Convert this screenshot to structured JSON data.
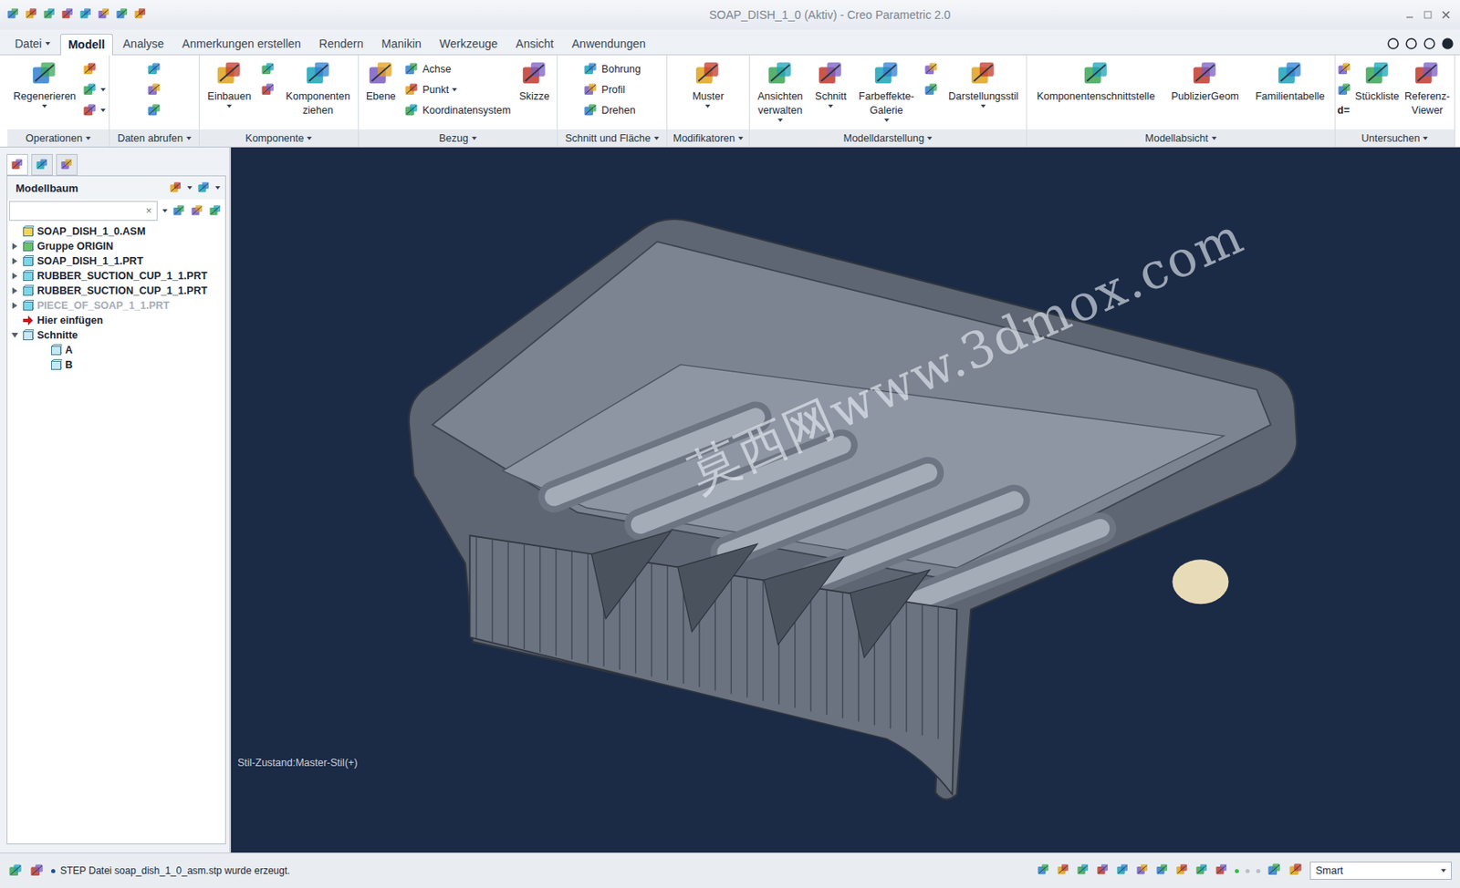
{
  "window": {
    "title": "SOAP_DISH_1_0 (Aktiv) - Creo Parametric 2.0"
  },
  "tabs": [
    {
      "label": "Datei",
      "selected": false,
      "dropdown": true
    },
    {
      "label": "Modell",
      "selected": true,
      "dropdown": false
    },
    {
      "label": "Analyse",
      "selected": false,
      "dropdown": false
    },
    {
      "label": "Anmerkungen erstellen",
      "selected": false,
      "dropdown": false
    },
    {
      "label": "Rendern",
      "selected": false,
      "dropdown": false
    },
    {
      "label": "Manikin",
      "selected": false,
      "dropdown": false
    },
    {
      "label": "Werkzeuge",
      "selected": false,
      "dropdown": false
    },
    {
      "label": "Ansicht",
      "selected": false,
      "dropdown": false
    },
    {
      "label": "Anwendungen",
      "selected": false,
      "dropdown": false
    }
  ],
  "ribbon": [
    {
      "label": "Operationen",
      "dropdown": true,
      "columns": [
        {
          "kind": "large",
          "lines": [
            "Regenerieren"
          ],
          "dropdown": true
        },
        {
          "kind": "stack",
          "items": [
            {
              "label": "",
              "dropdown": false
            },
            {
              "label": "",
              "dropdown": true
            },
            {
              "label": "",
              "dropdown": true
            }
          ]
        }
      ]
    },
    {
      "label": "Daten abrufen",
      "dropdown": true,
      "columns": [
        {
          "kind": "stack",
          "items": [
            {
              "label": "",
              "dropdown": false
            },
            {
              "label": "",
              "dropdown": false
            },
            {
              "label": "",
              "dropdown": false
            }
          ]
        }
      ]
    },
    {
      "label": "Komponente",
      "dropdown": true,
      "columns": [
        {
          "kind": "large",
          "lines": [
            "Einbauen"
          ],
          "dropdown": true
        },
        {
          "kind": "stack",
          "items": [
            {
              "label": "",
              "dropdown": false
            },
            {
              "label": "",
              "dropdown": false
            }
          ]
        },
        {
          "kind": "large",
          "lines": [
            "Komponenten",
            "ziehen"
          ],
          "dropdown": false
        }
      ]
    },
    {
      "label": "Bezug",
      "dropdown": true,
      "columns": [
        {
          "kind": "large",
          "lines": [
            "Ebene"
          ],
          "dropdown": false
        },
        {
          "kind": "stack",
          "items": [
            {
              "label": "Achse",
              "dropdown": false
            },
            {
              "label": "Punkt",
              "dropdown": true
            },
            {
              "label": "Koordinatensystem",
              "dropdown": false
            }
          ]
        },
        {
          "kind": "large",
          "lines": [
            "Skizze"
          ],
          "dropdown": false
        }
      ]
    },
    {
      "label": "Schnitt und Fläche",
      "dropdown": true,
      "columns": [
        {
          "kind": "stack",
          "items": [
            {
              "label": "Bohrung",
              "dropdown": false
            },
            {
              "label": "Profil",
              "dropdown": false
            },
            {
              "label": "Drehen",
              "dropdown": false
            }
          ]
        }
      ]
    },
    {
      "label": "Modifikatoren",
      "dropdown": true,
      "columns": [
        {
          "kind": "large",
          "lines": [
            "Muster"
          ],
          "dropdown": true
        }
      ]
    },
    {
      "label": "Modelldarstellung",
      "dropdown": true,
      "columns": [
        {
          "kind": "large",
          "lines": [
            "Ansichten",
            "verwalten"
          ],
          "dropdown": true
        },
        {
          "kind": "large",
          "lines": [
            "Schnitt"
          ],
          "dropdown": true
        },
        {
          "kind": "large",
          "lines": [
            "Farbeffekte-",
            "Galerie"
          ],
          "dropdown": true
        },
        {
          "kind": "stack",
          "items": [
            {
              "label": "",
              "dropdown": false
            },
            {
              "label": "",
              "dropdown": false
            }
          ]
        },
        {
          "kind": "large",
          "lines": [
            "Darstellungsstil"
          ],
          "dropdown": true
        }
      ]
    },
    {
      "label": "Modellabsicht",
      "dropdown": true,
      "columns": [
        {
          "kind": "large",
          "lines": [
            "Komponentenschnittstelle"
          ],
          "dropdown": false
        },
        {
          "kind": "large",
          "lines": [
            "PublizierGeom"
          ],
          "dropdown": false
        },
        {
          "kind": "large",
          "lines": [
            "Familientabelle"
          ],
          "dropdown": false
        }
      ]
    },
    {
      "label": "Untersuchen",
      "dropdown": true,
      "columns": [
        {
          "kind": "stack",
          "items": [
            {
              "label": "",
              "dropdown": false
            },
            {
              "label": "",
              "dropdown": false
            },
            {
              "label": "d=",
              "dropdown": false
            }
          ]
        },
        {
          "kind": "large",
          "lines": [
            "Stückliste"
          ],
          "dropdown": false
        },
        {
          "kind": "large",
          "lines": [
            "Referenz-",
            "Viewer"
          ],
          "dropdown": false
        }
      ]
    }
  ],
  "model_tree": {
    "title": "Modellbaum",
    "search": {
      "value": "",
      "clear": "×"
    },
    "items": [
      {
        "label": "SOAP_DISH_1_0.ASM",
        "kind": "asm",
        "level": 0,
        "expander": "none",
        "disabled": false
      },
      {
        "label": "Gruppe ORIGIN",
        "kind": "group",
        "level": 0,
        "expander": "collapsed",
        "disabled": false
      },
      {
        "label": "SOAP_DISH_1_1.PRT",
        "kind": "part",
        "level": 0,
        "expander": "collapsed",
        "disabled": false
      },
      {
        "label": "RUBBER_SUCTION_CUP_1_1.PRT",
        "kind": "part",
        "level": 0,
        "expander": "collapsed",
        "disabled": false
      },
      {
        "label": "RUBBER_SUCTION_CUP_1_1.PRT",
        "kind": "part",
        "level": 0,
        "expander": "collapsed",
        "disabled": false
      },
      {
        "label": "PIECE_OF_SOAP_1_1.PRT",
        "kind": "part",
        "level": 0,
        "expander": "collapsed",
        "disabled": true
      },
      {
        "label": "Hier einfügen",
        "kind": "insert",
        "level": 0,
        "expander": "none",
        "disabled": false
      },
      {
        "label": "Schnitte",
        "kind": "folder",
        "level": 0,
        "expander": "expanded",
        "disabled": false
      },
      {
        "label": "A",
        "kind": "section",
        "level": 1,
        "expander": "none",
        "disabled": false
      },
      {
        "label": "B",
        "kind": "section",
        "level": 1,
        "expander": "none",
        "disabled": false
      }
    ]
  },
  "viewport": {
    "watermark": "莫西网www.3dmox.com",
    "style_state": "Stil-Zustand:Master-Stil(+)"
  },
  "status_bar": {
    "message": "STEP Datei soap_dish_1_0_asm.stp wurde erzeugt.",
    "filter": "Smart"
  }
}
